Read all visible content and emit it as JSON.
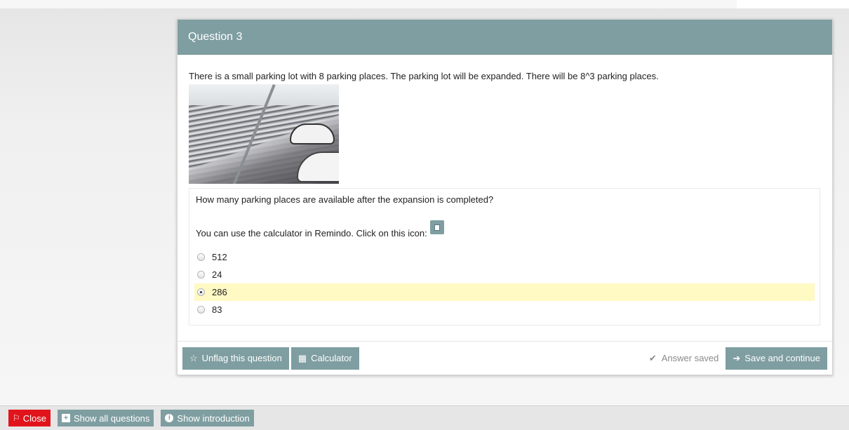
{
  "question": {
    "title": "Question 3",
    "text": "There is a small parking lot with 8 parking places. The parking lot will be expanded. There will be 8^3 parking places.",
    "image_alt": "parking-lot-photo",
    "sub_question": "How many parking places are available after the expansion is completed?",
    "calculator_hint": "You can use the calculator in Remindo. Click on this icon:",
    "options": [
      {
        "label": "512",
        "selected": false
      },
      {
        "label": "24",
        "selected": false
      },
      {
        "label": "286",
        "selected": true
      },
      {
        "label": "83",
        "selected": false
      }
    ]
  },
  "footer": {
    "unflag_label": "Unflag this question",
    "calculator_label": "Calculator",
    "saved_status": "Answer saved",
    "save_continue_label": "Save and continue"
  },
  "bottom_bar": {
    "close_label": "Close",
    "show_all_label": "Show all questions",
    "show_intro_label": "Show introduction"
  },
  "colors": {
    "accent": "#7f9ea1",
    "danger": "#e1141c",
    "selected_highlight": "#fff9c4"
  },
  "icons": {
    "unflag": "star-outline-icon",
    "calculator": "calculator-icon",
    "saved": "check-icon",
    "save_continue": "arrow-right-icon",
    "close": "flag-icon",
    "show_all": "plus-square-icon",
    "show_intro": "info-circle-icon"
  }
}
